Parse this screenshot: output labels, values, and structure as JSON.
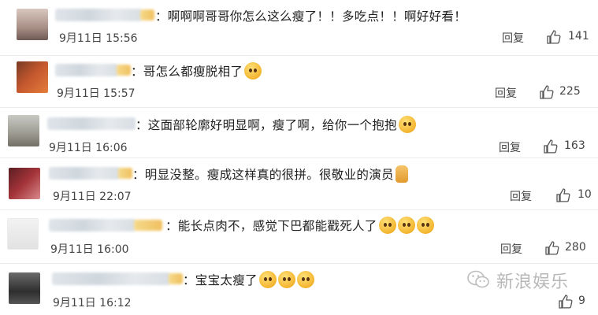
{
  "comments": [
    {
      "text": "：啊啊啊哥哥你怎么这么瘦了！！多吃点！！啊好好看！",
      "time": "9月11日 15:56",
      "reply": "回复",
      "likes": "141"
    },
    {
      "text": "：哥怎么都瘦脱相了",
      "time": "9月11日 15:57",
      "reply": "回复",
      "likes": "225"
    },
    {
      "text": "：这面部轮廓好明显啊，瘦了啊，给你一个抱抱",
      "time": "9月11日 16:06",
      "reply": "回复",
      "likes": "163"
    },
    {
      "text": "：明显没整。瘦成这样真的很拼。很敬业的演员",
      "time": "9月11日 22:07",
      "reply": "回复",
      "likes": "10"
    },
    {
      "text": "：能长点肉不，感觉下巴都能戳死人了",
      "time": "9月11日 16:00",
      "reply": "回复",
      "likes": "280"
    },
    {
      "text": "：宝宝太瘦了",
      "time": "9月11日 16:12",
      "reply": "回复",
      "likes": "9"
    }
  ],
  "watermark": {
    "text": "新浪娱乐",
    "icon": "wechat-icon"
  },
  "icons": {
    "like": "thumbs-up-icon",
    "emoji": "emoji-face-icon"
  }
}
